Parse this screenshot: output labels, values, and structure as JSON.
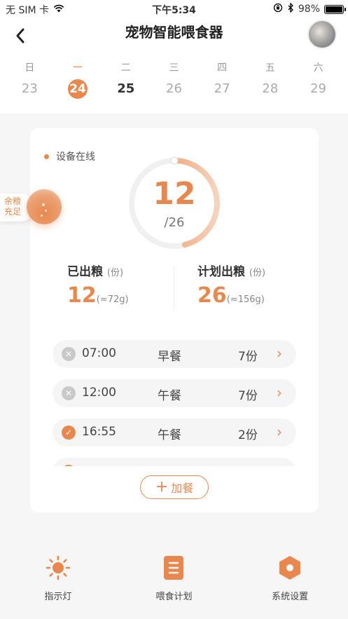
{
  "status_bar": {
    "carrier": "无 SIM 卡",
    "time": "下午5:34",
    "battery": "98%",
    "battery_level": 0.98
  },
  "header": {
    "title": "宠物智能喂食器"
  },
  "calendar": {
    "days": [
      {
        "weekday": "日",
        "date": "23"
      },
      {
        "weekday": "一",
        "date": "24"
      },
      {
        "weekday": "二",
        "date": "25"
      },
      {
        "weekday": "三",
        "date": "26"
      },
      {
        "weekday": "四",
        "date": "27"
      },
      {
        "weekday": "五",
        "date": "28"
      },
      {
        "weekday": "六",
        "date": "29"
      }
    ]
  },
  "device": {
    "status": "设备在线",
    "dispensed": "12",
    "planned_total": "/26",
    "progress_fraction": 0.46
  },
  "food_level": {
    "label_line1": "余粮",
    "label_line2": "充足"
  },
  "stats": {
    "dispensed_label": "已出粮",
    "dispensed_unit": "(份)",
    "dispensed_value": "12",
    "dispensed_weight": "(≈72g)",
    "planned_label": "计划出粮",
    "planned_unit": "(份)",
    "planned_value": "26",
    "planned_weight": "(≈156g)"
  },
  "meals": [
    {
      "time": "07:00",
      "name": "早餐",
      "portion": "7份",
      "done": false
    },
    {
      "time": "12:00",
      "name": "午餐",
      "portion": "7份",
      "done": false
    },
    {
      "time": "16:55",
      "name": "午餐",
      "portion": "2份",
      "done": true
    }
  ],
  "add_meal": {
    "label": "加餐"
  },
  "tabbar": {
    "items": [
      {
        "label": "指示灯",
        "icon": "sun-icon"
      },
      {
        "label": "喂食计划",
        "icon": "document-icon"
      },
      {
        "label": "系统设置",
        "icon": "hexagon-settings-icon"
      }
    ]
  },
  "colors": {
    "accent": "#e8884e"
  }
}
